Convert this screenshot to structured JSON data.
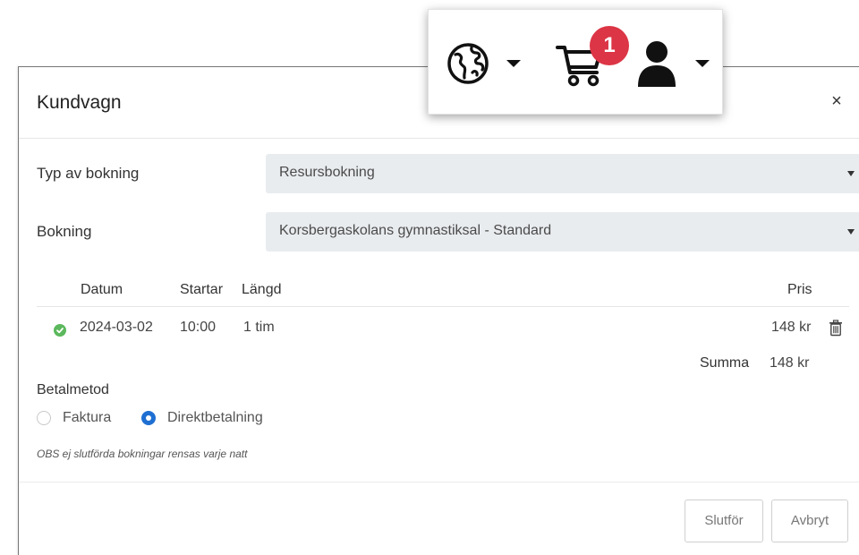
{
  "navbar": {
    "globe_icon": "globe-icon",
    "cart_icon": "cart-icon",
    "cart_count": "1",
    "user_icon": "user-icon"
  },
  "modal": {
    "title": "Kundvagn",
    "close_label": "×",
    "booking_type": {
      "label": "Typ av bokning",
      "value": "Resursbokning"
    },
    "booking": {
      "label": "Bokning",
      "value": "Korsbergaskolans gymnastiksal - Standard"
    },
    "table": {
      "headers": {
        "date": "Datum",
        "start": "Startar",
        "length": "Längd",
        "price": "Pris"
      },
      "rows": [
        {
          "date": "2024-03-02",
          "start": "10:00",
          "length": "1 tim",
          "price": "148 kr",
          "status": "ok"
        }
      ],
      "sum_label": "Summa",
      "sum_value": "148 kr"
    },
    "payment": {
      "label": "Betalmetod",
      "options": [
        {
          "label": "Faktura",
          "selected": false
        },
        {
          "label": "Direktbetalning",
          "selected": true
        }
      ]
    },
    "note": "OBS ej slutförda bokningar rensas varje natt",
    "buttons": {
      "finish": "Slutför",
      "cancel": "Avbryt"
    }
  },
  "colors": {
    "accent": "#1f6fd2",
    "badge": "#dc3545",
    "success": "#5cb85c",
    "select_bg": "#e9ecef"
  }
}
